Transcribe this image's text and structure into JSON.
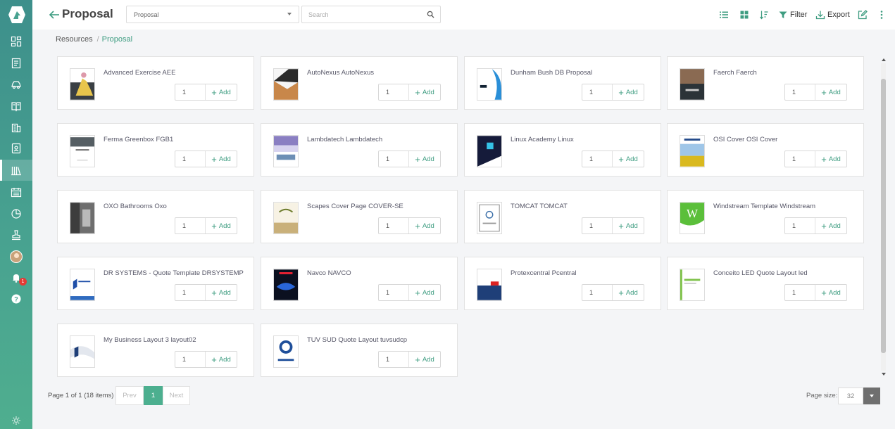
{
  "header": {
    "title": "Proposal",
    "type_select": "Proposal",
    "search_placeholder": "Search",
    "filter_label": "Filter",
    "export_label": "Export"
  },
  "sidebar": {
    "notification_count": "1",
    "icons": [
      "dashboard-icon",
      "document-icon",
      "car-icon",
      "book-icon",
      "building-icon",
      "contact-card-icon",
      "library-icon",
      "calendar-icon",
      "chart-icon",
      "stamp-icon",
      "avatar",
      "bell-icon",
      "help-icon",
      "settings-icon"
    ],
    "active": "library-icon",
    "accent": "#48a290"
  },
  "breadcrumb": {
    "root": "Resources",
    "sep": "/",
    "current": "Proposal"
  },
  "items": [
    {
      "title": "Advanced Exercise AEE",
      "qty": "1",
      "add": "Add"
    },
    {
      "title": "AutoNexus AutoNexus",
      "qty": "1",
      "add": "Add"
    },
    {
      "title": "Dunham Bush DB Proposal",
      "qty": "1",
      "add": "Add"
    },
    {
      "title": "Faerch Faerch",
      "qty": "1",
      "add": "Add"
    },
    {
      "title": "Ferma Greenbox FGB1",
      "qty": "1",
      "add": "Add"
    },
    {
      "title": "Lambdatech Lambdatech",
      "qty": "1",
      "add": "Add"
    },
    {
      "title": "Linux Academy Linux",
      "qty": "1",
      "add": "Add"
    },
    {
      "title": "OSI Cover OSI Cover",
      "qty": "1",
      "add": "Add"
    },
    {
      "title": "OXO Bathrooms Oxo",
      "qty": "1",
      "add": "Add"
    },
    {
      "title": "Scapes Cover Page COVER-SE",
      "qty": "1",
      "add": "Add"
    },
    {
      "title": "TOMCAT TOMCAT",
      "qty": "1",
      "add": "Add"
    },
    {
      "title": "Windstream Template Windstream",
      "qty": "1",
      "add": "Add"
    },
    {
      "title": "DR SYSTEMS - Quote Template DRSYSTEMP",
      "qty": "1",
      "add": "Add"
    },
    {
      "title": "Navco NAVCO",
      "qty": "1",
      "add": "Add"
    },
    {
      "title": "Protexcentral Pcentral",
      "qty": "1",
      "add": "Add"
    },
    {
      "title": "Conceito LED Quote Layout led",
      "qty": "1",
      "add": "Add"
    },
    {
      "title": "My Business Layout 3 layout02",
      "qty": "1",
      "add": "Add"
    },
    {
      "title": "TUV SUD Quote Layout tuvsudcp",
      "qty": "1",
      "add": "Add"
    }
  ],
  "pagination": {
    "info": "Page 1 of 1 (18 items)",
    "prev": "Prev",
    "current": "1",
    "next": "Next",
    "page_size_label": "Page size:",
    "page_size": "32"
  },
  "colors": {
    "accent": "#3d9c80",
    "active_page": "#4caf8f"
  }
}
